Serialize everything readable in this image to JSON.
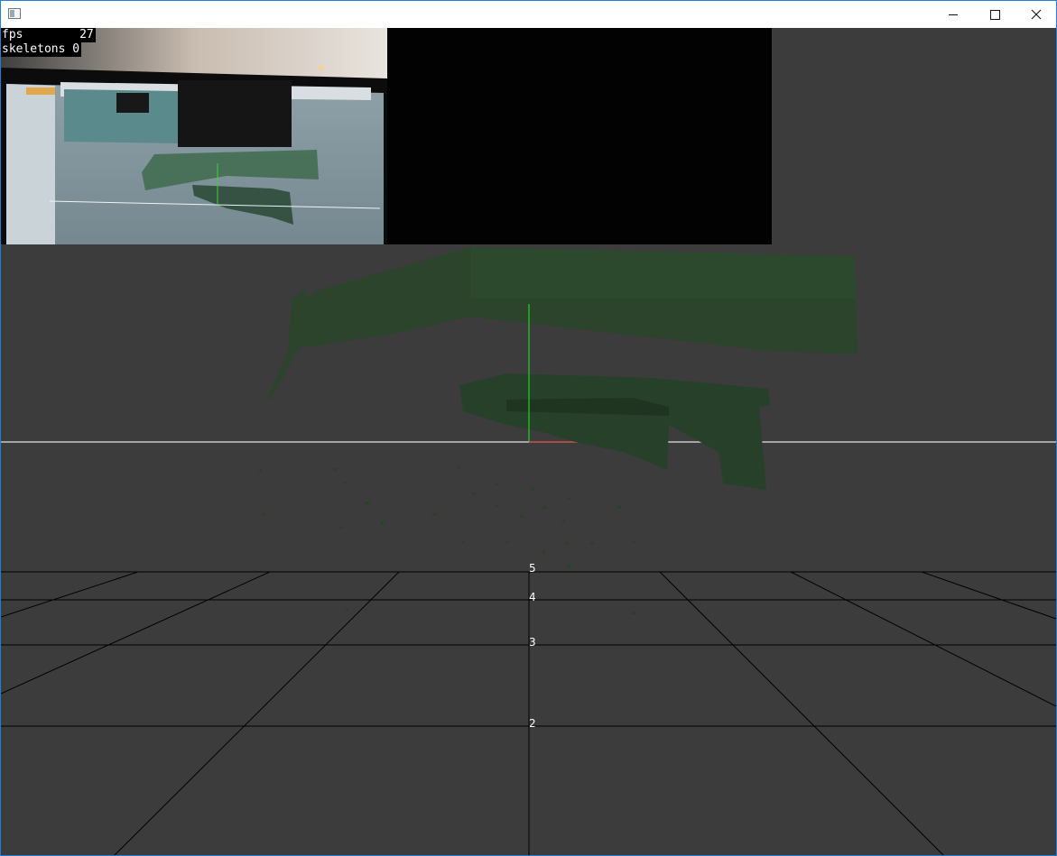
{
  "window": {
    "title": "",
    "controls": {
      "minimize_icon": "minimize-icon",
      "maximize_icon": "maximize-icon",
      "close_icon": "close-icon"
    }
  },
  "hud": {
    "fps_label": "fps",
    "fps_value": "27",
    "skeletons_label": "skeletons",
    "skeletons_value": "0"
  },
  "floor_grid": {
    "distance_labels": [
      "5",
      "4",
      "3",
      "2"
    ]
  },
  "colors": {
    "background": "#3c3c3c",
    "grid_line": "#000000",
    "axis_y": "#22d022",
    "axis_x": "#c8c8c8",
    "point_cloud": "#2b4a2b",
    "window_border": "#1e7fd6"
  }
}
